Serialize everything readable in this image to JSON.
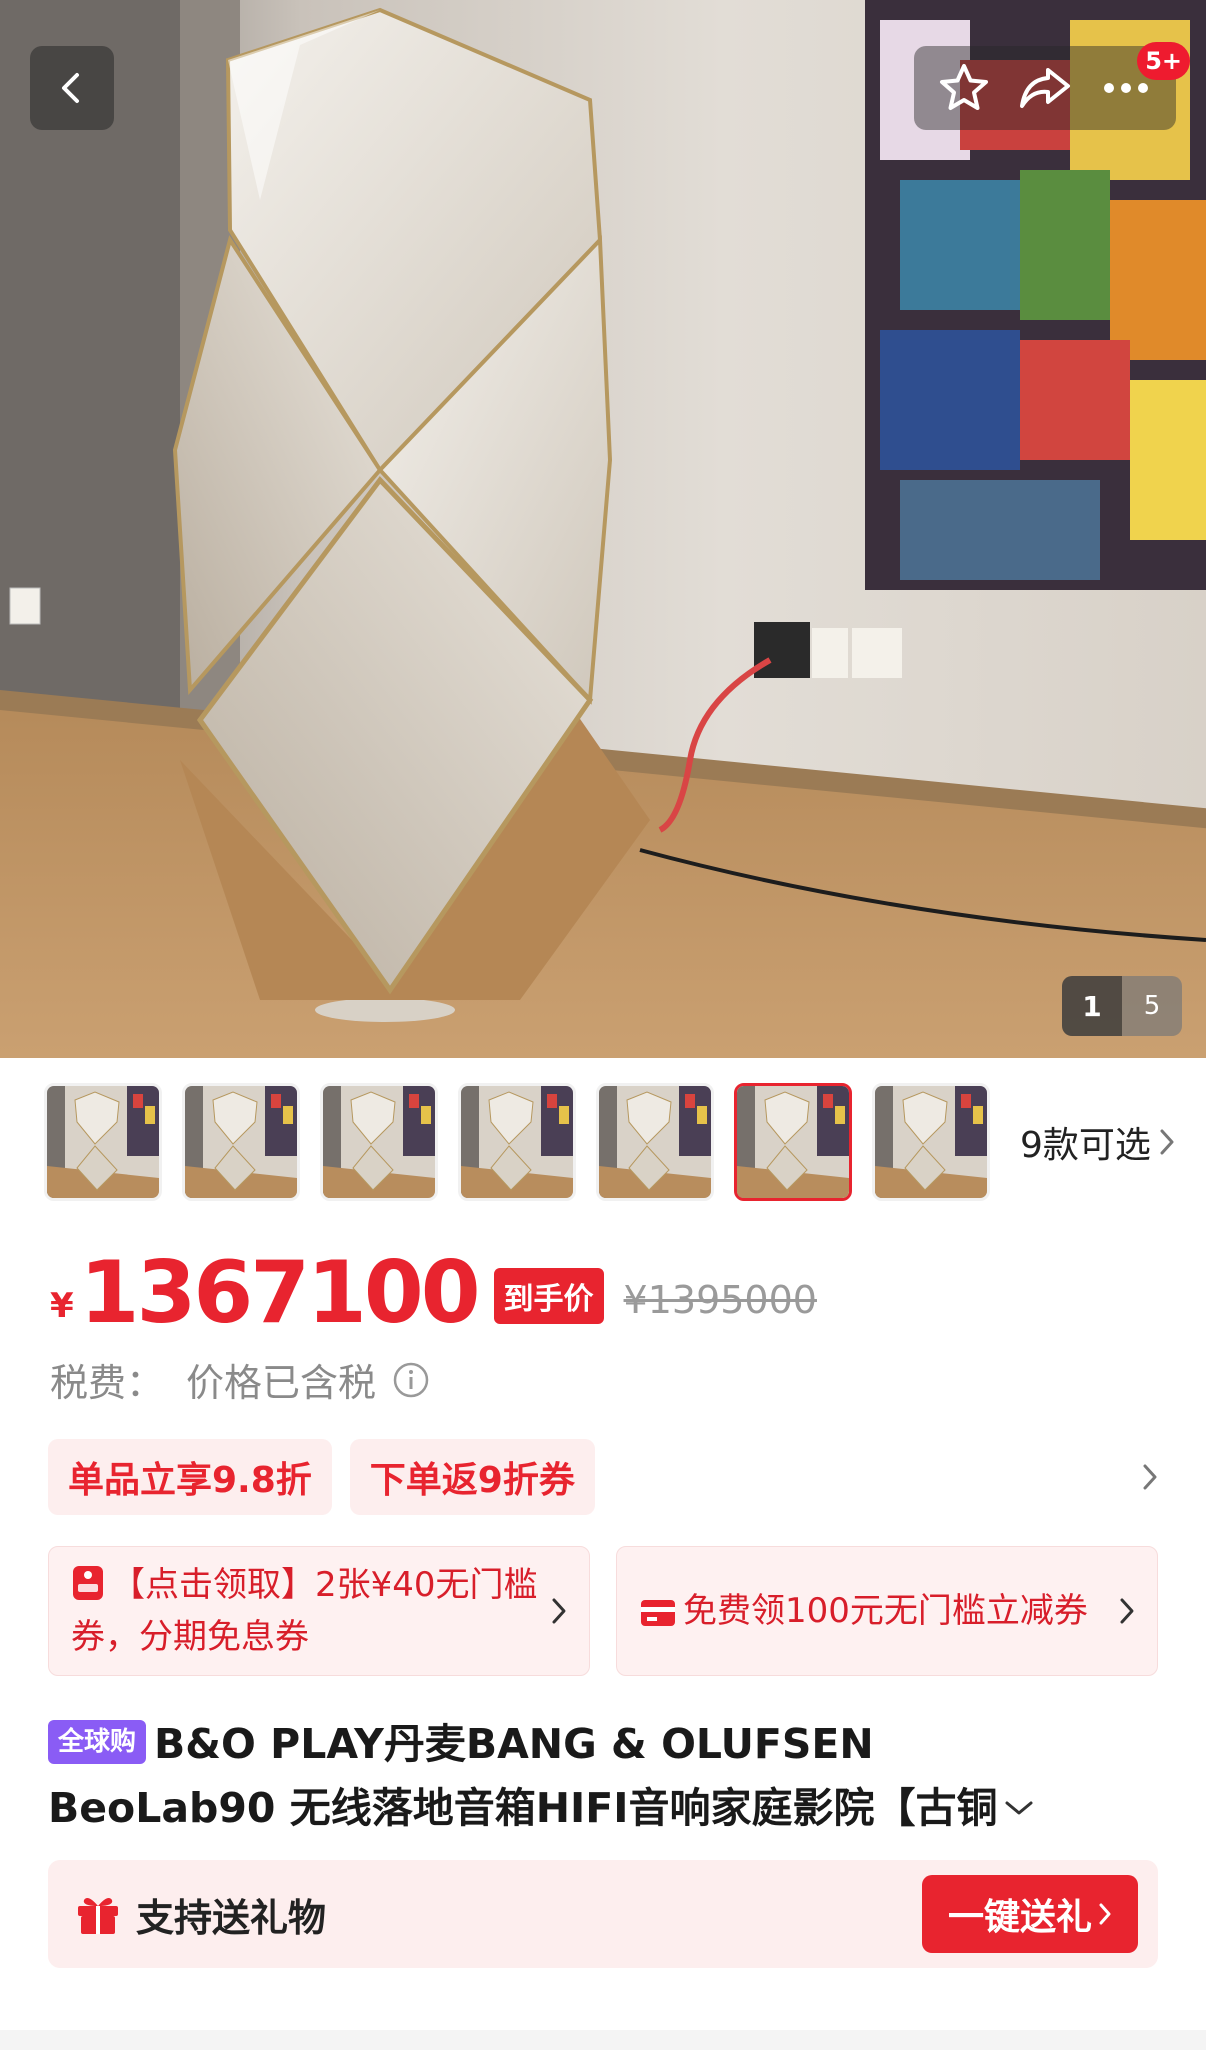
{
  "hero": {
    "current_page": "1",
    "total_pages": "5",
    "notification_count": "5+"
  },
  "thumbs": {
    "selected_index": 5,
    "more_label": "9款可选"
  },
  "price": {
    "currency": "¥",
    "current": "1367100",
    "tag": "到手价",
    "original": "¥1395000"
  },
  "tax": {
    "label": "税费：",
    "value": "价格已含税"
  },
  "promos": [
    "单品立享9.8折",
    "下单返9折券"
  ],
  "coupons": [
    {
      "text": "【点击领取】2张¥40无门槛券，分期免息券",
      "icon": "coupon-badge-icon"
    },
    {
      "text": "免费领100元无门槛立减券",
      "icon": "card-icon"
    }
  ],
  "title": {
    "badge": "全球购",
    "line1": "B&O PLAY丹麦BANG & OLUFSEN",
    "line2": "BeoLab90 无线落地音箱HIFI音响家庭影院【古铜"
  },
  "gift": {
    "label": "支持送礼物",
    "button": "一键送礼"
  },
  "colors": {
    "accent": "#e8242f",
    "promo_bg": "#fdeeee",
    "global_badge": "#8a5cf5"
  }
}
